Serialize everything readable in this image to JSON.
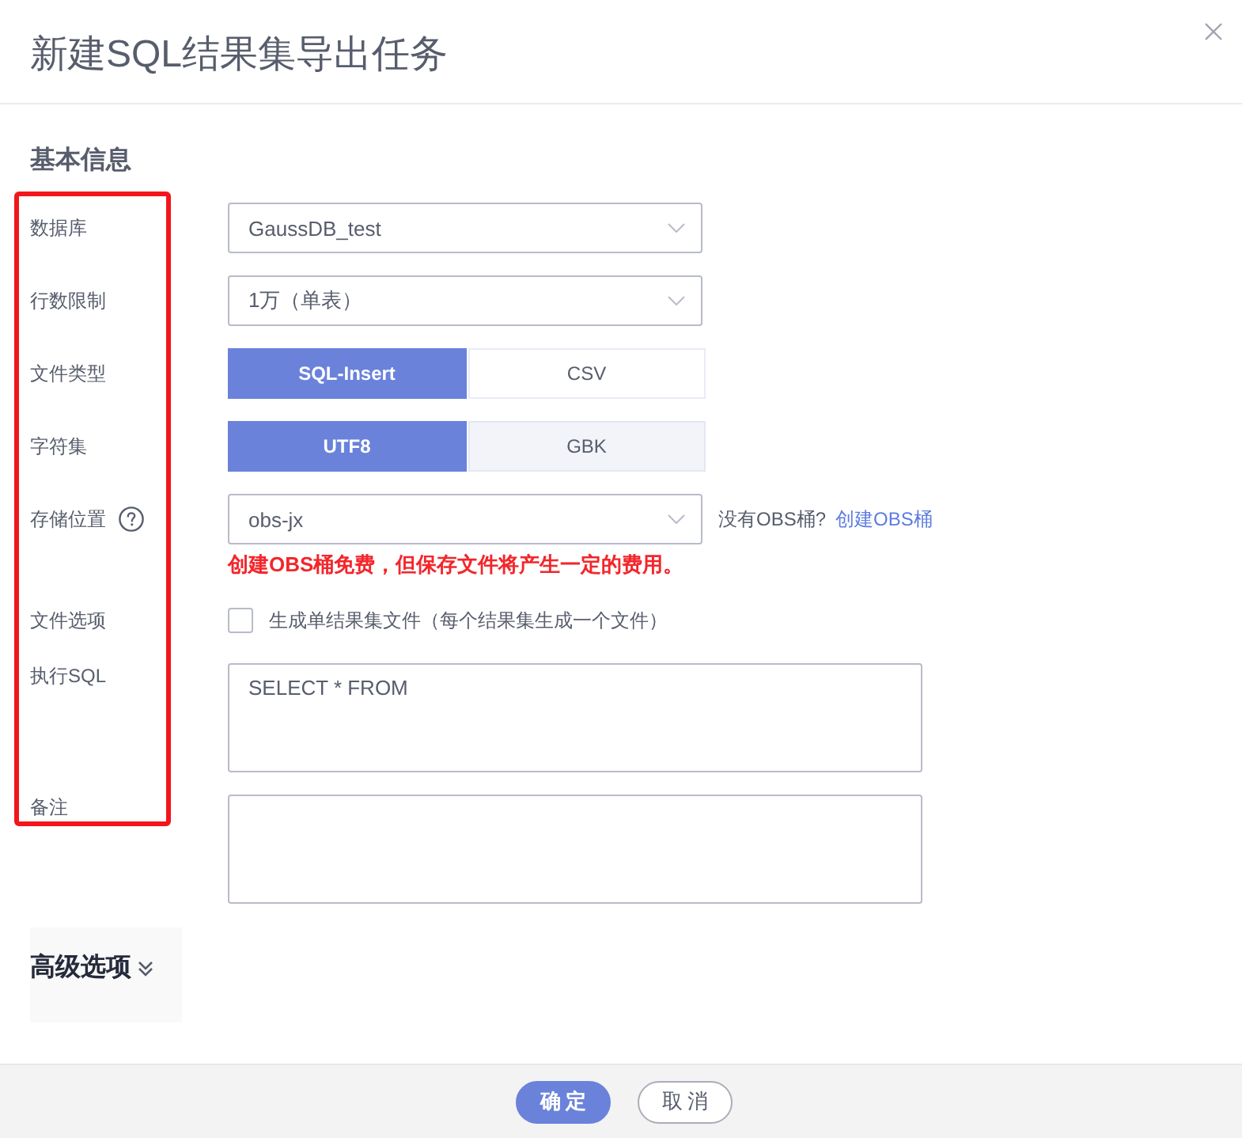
{
  "dialog": {
    "title": "新建SQL结果集导出任务"
  },
  "section_title": "基本信息",
  "label_highlight": true,
  "fields": [
    {
      "kind": "select",
      "label": "数据库",
      "value": "GaussDB_test"
    },
    {
      "kind": "select",
      "label": "行数限制",
      "value": "1万（单表）"
    },
    {
      "kind": "segmented",
      "label": "文件类型",
      "options": [
        {
          "label": "SQL-Insert",
          "selected": true,
          "hovered": false
        },
        {
          "label": "CSV",
          "selected": false,
          "hovered": false
        }
      ]
    },
    {
      "kind": "segmented",
      "label": "字符集",
      "options": [
        {
          "label": "UTF8",
          "selected": true,
          "hovered": false
        },
        {
          "label": "GBK",
          "selected": false,
          "hovered": true
        }
      ]
    },
    {
      "kind": "select",
      "label": "存储位置",
      "help": true,
      "value": "obs-jx",
      "note": "没有OBS桶?",
      "link": "创建OBS桶",
      "warning": "创建OBS桶免费，但保存文件将产生一定的费用。"
    },
    {
      "kind": "checkbox",
      "label": "文件选项",
      "text": "生成单结果集文件（每个结果集生成一个文件）",
      "checked": false
    },
    {
      "kind": "textarea",
      "label": "执行SQL",
      "value": "SELECT * FROM"
    },
    {
      "kind": "textarea",
      "label": "备注"
    }
  ],
  "advanced": {
    "label": "高级选项",
    "expanded": false
  },
  "buttons": [
    {
      "label": "确定",
      "kind": "primary"
    },
    {
      "label": "取消",
      "kind": "secondary"
    }
  ]
}
